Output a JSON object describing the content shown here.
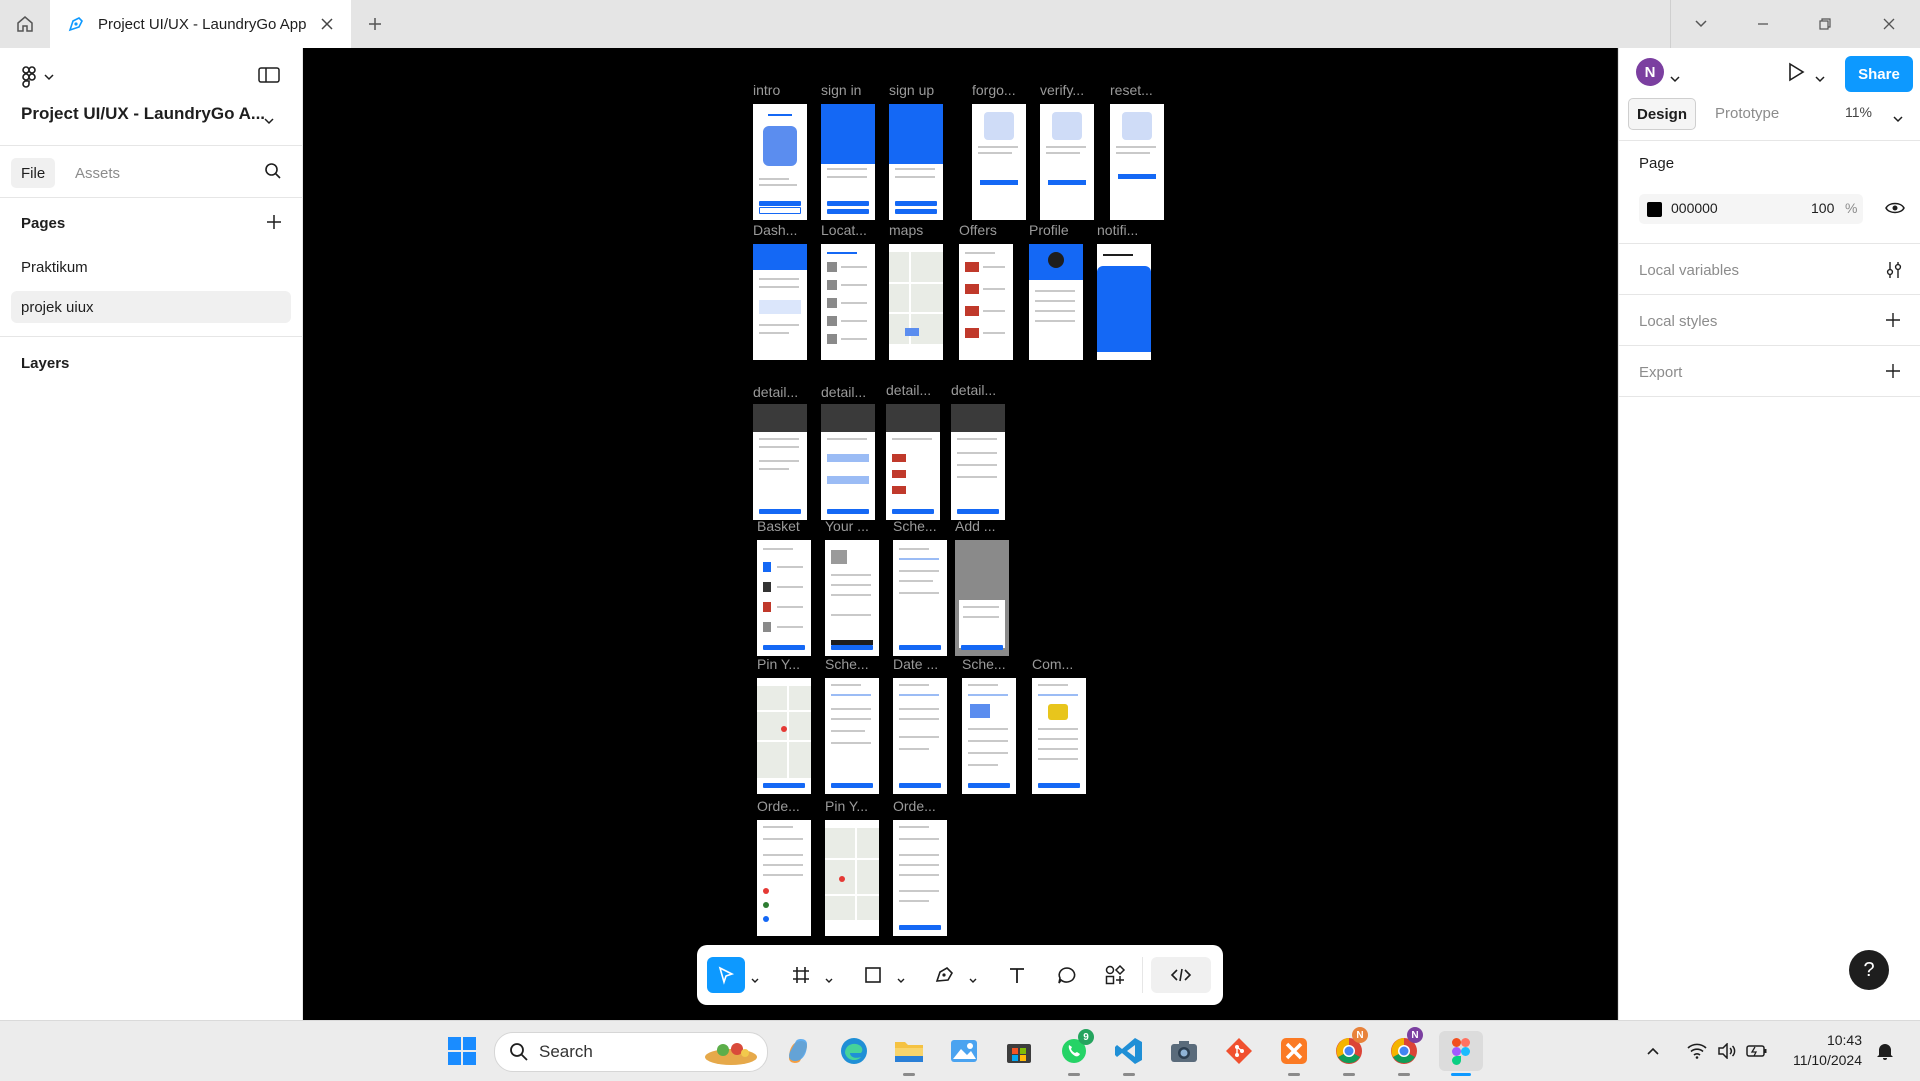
{
  "window": {
    "tab_title": "Project UI/UX - LaundryGo App"
  },
  "left_panel": {
    "project_name": "Project UI/UX - LaundryGo A...",
    "tabs": [
      "File",
      "Assets"
    ],
    "pages_heading": "Pages",
    "pages": [
      "Praktikum",
      "projek uiux"
    ],
    "selected_page": "projek uiux",
    "layers_heading": "Layers"
  },
  "canvas": {
    "background": "#000000",
    "rows": [
      {
        "labels": [
          "intro",
          "sign in",
          "sign up",
          "forgo...",
          "verify...",
          "reset..."
        ]
      },
      {
        "labels": [
          "Dash...",
          "Locat...",
          "maps",
          "Offers",
          "Profile",
          "notifi..."
        ]
      },
      {
        "labels": [
          "detail...",
          "detail...",
          "detail...",
          "detail..."
        ]
      },
      {
        "labels": [
          "Basket",
          "Your ...",
          "Sche...",
          "Add ..."
        ]
      },
      {
        "labels": [
          "Pin Y...",
          "Sche...",
          "Date ...",
          "Sche...",
          "Com..."
        ]
      },
      {
        "labels": [
          "Orde...",
          "Pin Y...",
          "Orde..."
        ]
      }
    ]
  },
  "toolbar": {
    "tools": [
      "move-tool",
      "frame-tool",
      "rectangle-tool",
      "pen-tool",
      "text-tool",
      "comment-tool",
      "components-tool",
      "dev-mode-toggle"
    ]
  },
  "right_panel": {
    "avatar_initial": "N",
    "share_label": "Share",
    "tabs": [
      "Design",
      "Prototype"
    ],
    "zoom": "11%",
    "page_heading": "Page",
    "page_color_hex": "000000",
    "page_opacity": "100",
    "percent_sign": "%",
    "local_variables": "Local variables",
    "local_styles": "Local styles",
    "export": "Export",
    "help_label": "?"
  },
  "taskbar": {
    "search_placeholder": "Search",
    "whatsapp_badge": "9",
    "chrome_badge_1": "N",
    "chrome_badge_2": "N",
    "time": "10:43",
    "date": "11/10/2024"
  },
  "colors": {
    "accent": "#0d99ff",
    "app_blue": "#1468f5"
  }
}
